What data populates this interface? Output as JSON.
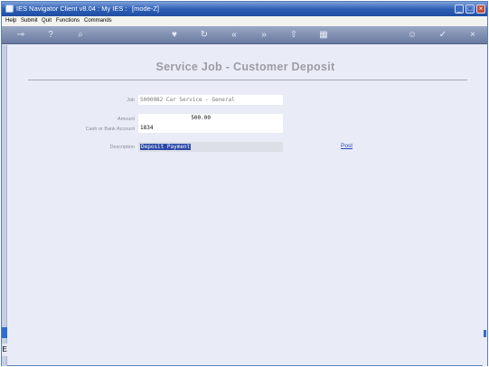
{
  "window": {
    "title": "IES Navigator Client v8.04 : My IES :",
    "mode": "[mode-Z]",
    "controls": {
      "minimize": "_",
      "maximize": "□",
      "close": "×"
    }
  },
  "menu": [
    "Help",
    "Submit",
    "Quit",
    "Functions",
    "Commands"
  ],
  "toolbar": {
    "icons": [
      "key-icon",
      "help-icon",
      "search-icon",
      "heart-icon",
      "refresh-icon",
      "back-icon",
      "forward-icon",
      "export-icon",
      "grid-icon",
      "user-icon",
      "check-icon",
      "close-icon"
    ],
    "glyphs": [
      "⊸",
      "?",
      "⌕",
      "♥",
      "↻",
      "«",
      "»",
      "⇧",
      "▦",
      "☺",
      "✓",
      "×"
    ]
  },
  "page": {
    "title": "Service Job - Customer Deposit"
  },
  "form": {
    "job_label": "Job",
    "job_value": "S000082 Car Service - General",
    "amount_label": "Amount",
    "amount_value": "500.00",
    "cash_label": "Cash or Bank Account",
    "cash_value": "1834",
    "description_label": "Description",
    "description_value": "Deposit Payment"
  },
  "actions": {
    "post": "Post"
  },
  "side": {
    "tab_label": "E"
  },
  "colors": {
    "titlebar": "#2e5fb6",
    "link": "#2b44b8",
    "selection": "#2b4aa8"
  }
}
